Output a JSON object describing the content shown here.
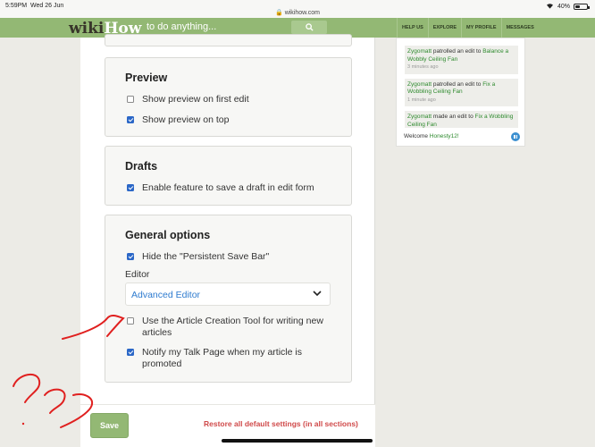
{
  "status_bar": {
    "time": "5:59PM",
    "date": "Wed 26 Jun",
    "url": "wikihow.com",
    "battery": "40%",
    "battery_level": 0.4
  },
  "header": {
    "logo_part1": "wiki",
    "logo_part2": "How",
    "search_placeholder": "to do anything...",
    "nav": [
      "HELP US",
      "EXPLORE",
      "MY PROFILE",
      "MESSAGES"
    ]
  },
  "preview": {
    "title": "Preview",
    "options": [
      {
        "label": "Show preview on first edit",
        "checked": false
      },
      {
        "label": "Show preview on top",
        "checked": true
      }
    ]
  },
  "drafts": {
    "title": "Drafts",
    "options": [
      {
        "label": "Enable feature to save a draft in edit form",
        "checked": true
      }
    ]
  },
  "general": {
    "title": "General options",
    "persistent_save": {
      "label": "Hide the \"Persistent Save Bar\"",
      "checked": true
    },
    "editor_label": "Editor",
    "editor_value": "Advanced Editor",
    "article_tool": {
      "label": "Use the Article Creation Tool for writing new articles",
      "checked": false
    },
    "notify_talk": {
      "label": "Notify my Talk Page when my article is promoted",
      "checked": true
    }
  },
  "footer": {
    "save": "Save",
    "restore": "Restore all default settings (in all sections)"
  },
  "sidebar": {
    "feed": [
      {
        "user": "Zygomatt",
        "action": "patrolled an edit to",
        "title": "Balance a Wobbly Ceiling Fan",
        "ago": "3 minutes ago"
      },
      {
        "user": "Zygomatt",
        "action": "patrolled an edit to",
        "title": "Fix a Wobbling Ceiling Fan",
        "ago": "1 minute ago"
      },
      {
        "user": "Zygomatt",
        "action": "made an edit to",
        "title": "Fix a Wobbling Ceiling Fan",
        "ago": ""
      }
    ],
    "welcome": "Welcome",
    "username": "Honesty12!"
  },
  "colors": {
    "brand_green": "#93b874",
    "checkbox_blue": "#2b67c7",
    "restore_red": "#d04a4a",
    "annotation_red": "#e0201f"
  }
}
